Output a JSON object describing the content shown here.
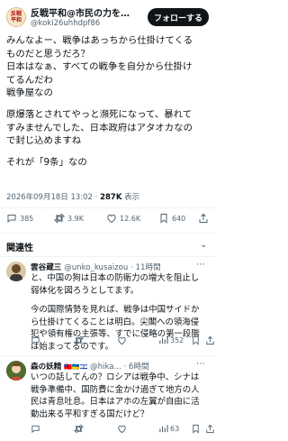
{
  "tweet": {
    "author_name": "反戦平和@市民の力を…",
    "handle": "@koki26uhhdpf86",
    "avatar_text": [
      "反戦",
      "平和"
    ],
    "follow_label": "フォローする",
    "lines": [
      "みんなよー、戦争はあっちから仕掛けてくる",
      "ものだと思うだろ？",
      "日本はなぁ、すべての戦争を自分から仕掛け",
      "てるんだわ",
      "戦争屋なの",
      "",
      "原爆落とされてやっと瀕死になって、暴れて",
      "すみませんでした、日本政府はアタオカなの",
      "で封じ込めますね",
      "",
      "それが「9条」なの"
    ],
    "timestamp": "2026年09月18日 13:02",
    "views_count": "287K",
    "views_label": "表示",
    "stats": {
      "replies": "385",
      "retweets": "3.9K",
      "likes": "12.6K",
      "bookmarks": "640"
    }
  },
  "related_label": "関連性",
  "replies": [
    {
      "name": "雲谷蔵三",
      "handle": "@unko_kusaizou",
      "time": "11時間",
      "lines": [
        "と、中国の狗は日本の防衛力の増大を阻止し",
        "弱体化を図ろうとしてます。",
        "",
        "今の国際情勢を見れば、戦争は中国サイドか",
        "ら仕掛けてくることは明白。尖閣への領海侵",
        "犯や領有権の主張等、すでに侵略の第一段階",
        "は始まってるのです。"
      ],
      "views": "352"
    },
    {
      "name": "森の妖精",
      "flags": "🇹🇼🇺🇦🇮🇱",
      "handle": "@hika...",
      "time": "6時間",
      "lines": [
        "いつの話してんの？ロシアは戦争中、シナは",
        "戦争準備中、国防費に金かけ過ぎて地方の人",
        "民は青息吐息。日本はアホの左翼が自由に活",
        "動出来る平和すぎる国だけど？"
      ],
      "views": "63"
    }
  ]
}
